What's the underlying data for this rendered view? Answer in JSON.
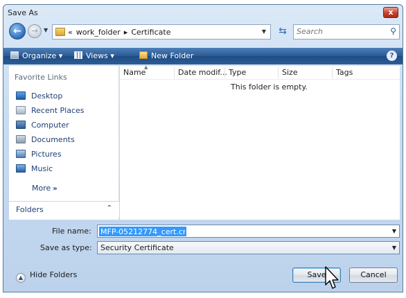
{
  "window": {
    "title": "Save As",
    "close_label": "x"
  },
  "nav": {
    "back_glyph": "←",
    "forward_glyph": "→",
    "breadcrumb": [
      "«",
      "work_folder",
      "▸",
      "Certificate"
    ],
    "search_placeholder": "Search"
  },
  "toolbar": {
    "organize_label": "Organize ▾",
    "views_label": "Views ▾",
    "new_folder_label": "New Folder",
    "help_label": "?"
  },
  "sidebar": {
    "header": "Favorite Links",
    "items": [
      {
        "label": "Desktop",
        "icon": "desktop-icon"
      },
      {
        "label": "Recent Places",
        "icon": "recent-places-icon"
      },
      {
        "label": "Computer",
        "icon": "computer-icon"
      },
      {
        "label": "Documents",
        "icon": "documents-icon"
      },
      {
        "label": "Pictures",
        "icon": "pictures-icon"
      },
      {
        "label": "Music",
        "icon": "music-icon"
      }
    ],
    "more_label": "More",
    "more_glyph": "»",
    "folders_label": "Folders",
    "folders_glyph": "⌃"
  },
  "file_list": {
    "columns": [
      "Name",
      "Date modif...",
      "Type",
      "Size",
      "Tags"
    ],
    "empty_message": "This folder is empty."
  },
  "form": {
    "file_name_label": "File name:",
    "file_name_value": "MFP-05212774_cert.crt",
    "save_as_type_label": "Save as type:",
    "save_as_type_value": "Security Certificate"
  },
  "footer": {
    "hide_folders_label": "Hide Folders",
    "save_label": "Save",
    "cancel_label": "Cancel"
  },
  "colors": {
    "toolbar": "#2a5a95",
    "selection": "#3399ff",
    "link_text": "#1e3f73"
  }
}
